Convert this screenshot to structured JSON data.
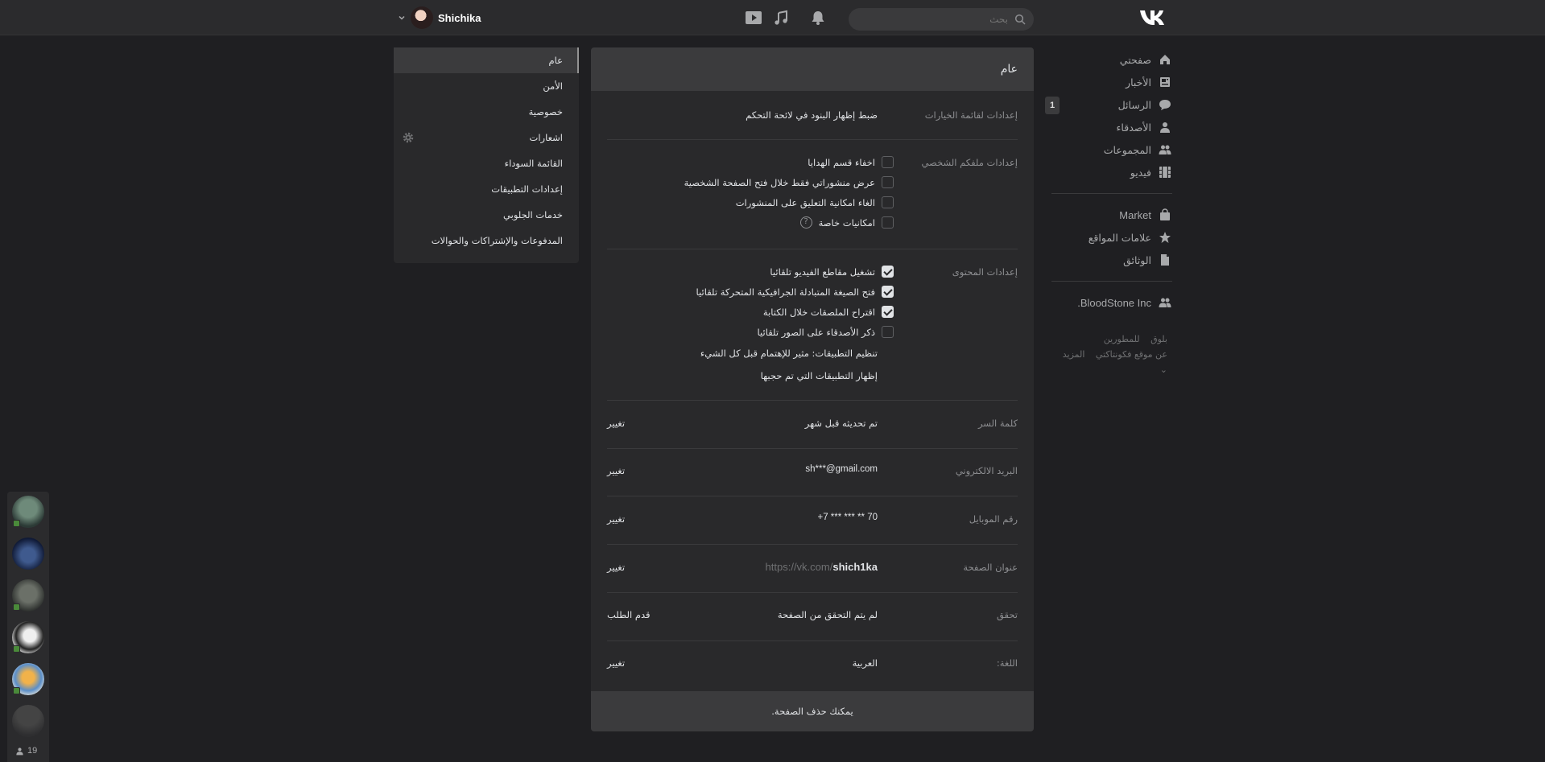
{
  "header": {
    "search_placeholder": "بحث",
    "user_name": "Shichika"
  },
  "left_nav": {
    "items": [
      {
        "label": "صفحتي",
        "icon": "home-icon"
      },
      {
        "label": "الأخبار",
        "icon": "news-icon"
      },
      {
        "label": "الرسائل",
        "icon": "messages-icon",
        "badge": "1"
      },
      {
        "label": "الأصدقاء",
        "icon": "friends-icon"
      },
      {
        "label": "المجموعات",
        "icon": "groups-icon"
      },
      {
        "label": "فيديو",
        "icon": "video-icon"
      },
      {
        "label": "Market",
        "icon": "market-icon"
      },
      {
        "label": "علامات المواقع",
        "icon": "bookmarks-icon"
      },
      {
        "label": "الوثائق",
        "icon": "documents-icon"
      },
      {
        "label": "BloodStone Inc.",
        "icon": "group-icon"
      }
    ],
    "footer": {
      "blog": "بلوق",
      "developers": "للمطورين",
      "about": "عن موقع فكونتاكتي",
      "more": "المزيد"
    }
  },
  "settings_menu": {
    "items": [
      "عام",
      "الأمن",
      "خصوصية",
      "اشعارات",
      "القائمة السوداء",
      "إعدادات التطبيقات",
      "خدمات الجلوبي",
      "المدفوعات والإشتراكات والحوالات"
    ]
  },
  "card": {
    "title": "عام",
    "menu_settings": {
      "label": "إعدادات لقائمة الخيارات",
      "value": "ضبط إظهار البنود في لائحة التحكم"
    },
    "profile_settings": {
      "label": "إعدادات ملفكم الشخصي",
      "options": [
        {
          "label": "اخفاء قسم الهدايا",
          "checked": false
        },
        {
          "label": "عرض منشوراتي فقط خلال فتح الصفحة الشخصية",
          "checked": false
        },
        {
          "label": "الغاء امكانية التعليق على المنشورات",
          "checked": false
        },
        {
          "label": "امكانيات خاصة",
          "checked": false,
          "help": "?"
        }
      ]
    },
    "content_settings": {
      "label": "إعدادات المحتوى",
      "options": [
        {
          "label": "تشغيل مقاطع الفيديو تلقائيا",
          "checked": true
        },
        {
          "label": "فتح الصيغة المتبادلة الجرافيكية المتحركة تلقائيا",
          "checked": true
        },
        {
          "label": "اقتراح الملصقات خلال الكتابة",
          "checked": true
        },
        {
          "label": "ذكر الأصدقاء على الصور تلقائيا",
          "checked": false
        }
      ],
      "apps_order": "تنظيم التطبيقات: مثير للإهتمام قبل كل الشيء",
      "show_hidden_apps": "إظهار التطبيقات التي تم حجبها"
    },
    "password": {
      "label": "كلمة السر",
      "value": "تم تحديثه قبل شهر",
      "action": "تغيير"
    },
    "email": {
      "label": "البريد الالكتروني",
      "value": "sh***@gmail.com",
      "action": "تغيير"
    },
    "phone": {
      "label": "رقم الموبايل",
      "value": "+7 *** *** ** 70",
      "action": "تغيير"
    },
    "page_address": {
      "label": "عنوان الصفحة",
      "prefix": "https://vk.com/",
      "value": "shich1ka",
      "action": "تغيير"
    },
    "verification": {
      "label": "تحقق",
      "value": "لم يتم التحقق من الصفحة",
      "action": "قدم الطلب"
    },
    "language": {
      "label": "اللغة:",
      "value": "العربية",
      "action": "تغيير"
    },
    "footer": "يمكنك حذف الصفحة."
  },
  "chats": {
    "online_count": "19"
  }
}
